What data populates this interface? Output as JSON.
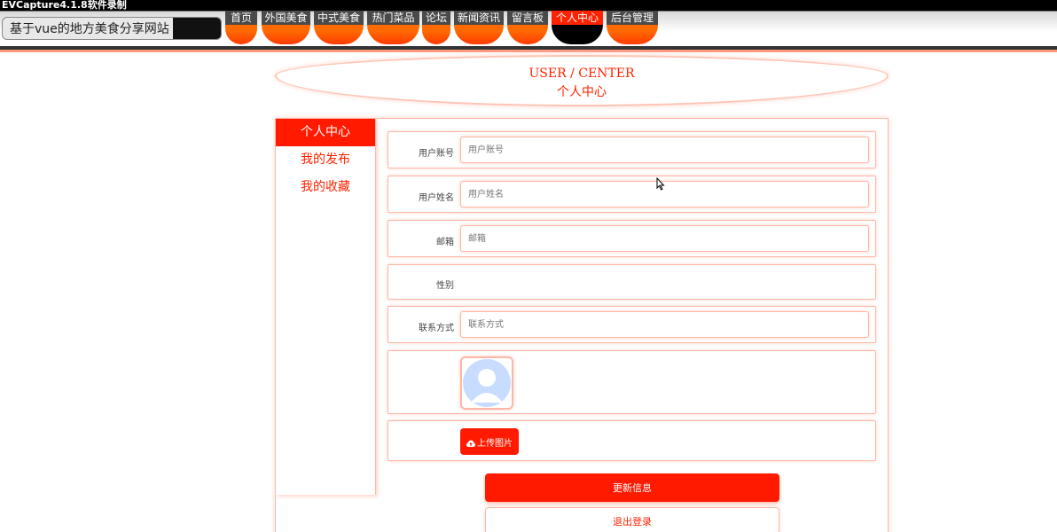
{
  "watermark": "EVCapture4.1.8软件录制",
  "site": {
    "title": "基于vue的地方美食分享网站"
  },
  "nav": {
    "items": [
      {
        "label": "首页"
      },
      {
        "label": "外国美食"
      },
      {
        "label": "中式美食"
      },
      {
        "label": "热门菜品"
      },
      {
        "label": "论坛"
      },
      {
        "label": "新闻资讯"
      },
      {
        "label": "留言板"
      },
      {
        "label": "个人中心"
      },
      {
        "label": "后台管理"
      }
    ],
    "active": "个人中心"
  },
  "banner": {
    "en": "USER / CENTER",
    "cn": "个人中心"
  },
  "sidebar": {
    "items": [
      {
        "label": "个人中心"
      },
      {
        "label": "我的发布"
      },
      {
        "label": "我的收藏"
      }
    ]
  },
  "form": {
    "account": {
      "label": "用户账号",
      "placeholder": "用户账号"
    },
    "username": {
      "label": "用户姓名",
      "placeholder": "用户姓名"
    },
    "email": {
      "label": "邮箱",
      "placeholder": "邮箱"
    },
    "gender": {
      "label": "性别"
    },
    "phone": {
      "label": "联系方式",
      "placeholder": "联系方式"
    },
    "upload_label": "上传图片",
    "update_label": "更新信息",
    "logout_label": "退出登录"
  },
  "colors": {
    "accent": "#ff1a00",
    "nav_orange": "#ff6a00",
    "border_pink": "#ffb6a6"
  }
}
